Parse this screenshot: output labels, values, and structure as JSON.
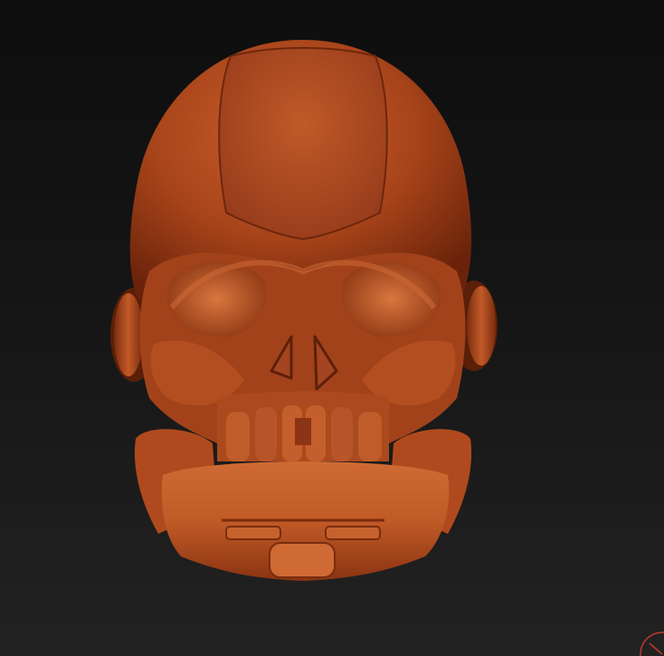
{
  "viewport": {
    "background": "#161616",
    "model": {
      "name": "skull-helmet-sculpt",
      "material_color": "#b8481c",
      "highlight_color": "#e07a45",
      "shadow_color": "#5e1e08"
    },
    "gizmo": {
      "icon": "axis-gizmo-icon",
      "color": "#c0392b"
    }
  }
}
